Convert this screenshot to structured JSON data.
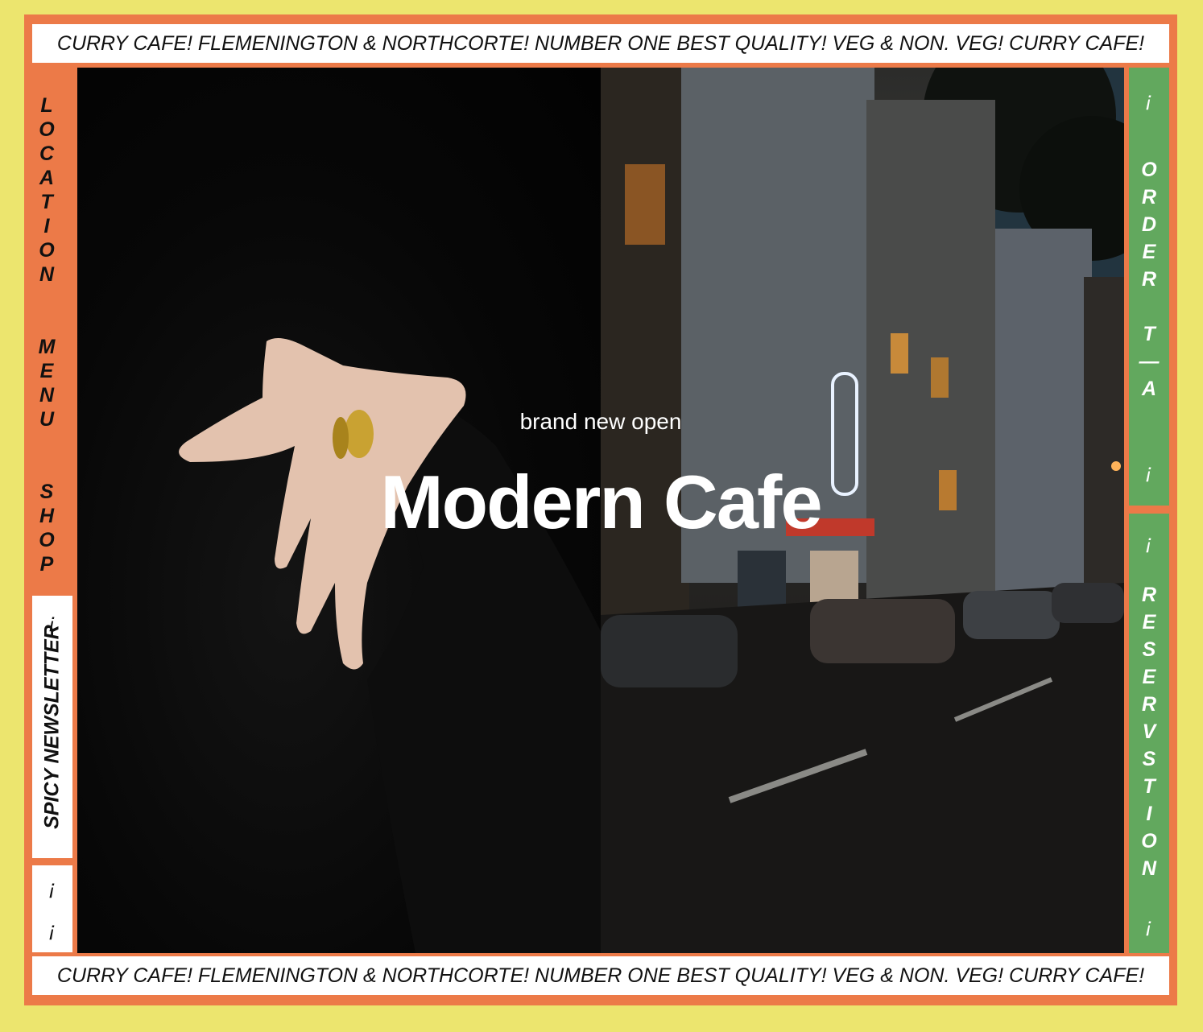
{
  "marquee": {
    "top_text": "CURRY CAFE! FLEMENINGTON & NORTHCORTE! NUMBER ONE BEST QUALITY! VEG & NON. VEG! CURRY CAFE!",
    "bottom_text": "CURRY CAFE! FLEMENINGTON & NORTHCORTE! NUMBER ONE BEST QUALITY! VEG & NON. VEG! CURRY CAFE!"
  },
  "left_nav": {
    "location": [
      "L",
      "O",
      "C",
      "A",
      "T",
      "I",
      "O",
      "N"
    ],
    "menu": [
      "M",
      "E",
      "N",
      "U"
    ],
    "shop": [
      "S",
      "H",
      "O",
      "P"
    ],
    "newsletter_label": "SPICY NEWSLETTER",
    "newsletter_icon": "¡",
    "info_icon_1": "¡",
    "info_icon_2": "¡"
  },
  "hero": {
    "subtitle": "brand new open",
    "title": "Modern Cafe"
  },
  "right_nav": {
    "order_icon_top": "¡",
    "order_ta": [
      "O",
      "R",
      "D",
      "E",
      "R",
      " ",
      "T",
      "—",
      "A"
    ],
    "order_icon_bottom": "¡",
    "reservation_icon_top": "¡",
    "reservation": [
      "R",
      "E",
      "S",
      "E",
      "R",
      "V",
      "S",
      "T",
      "I",
      "O",
      "N"
    ],
    "reservation_icon_bottom": "¡"
  },
  "colors": {
    "background": "#ece56e",
    "frame": "#ec7a48",
    "green": "#62a85e",
    "white": "#ffffff"
  }
}
